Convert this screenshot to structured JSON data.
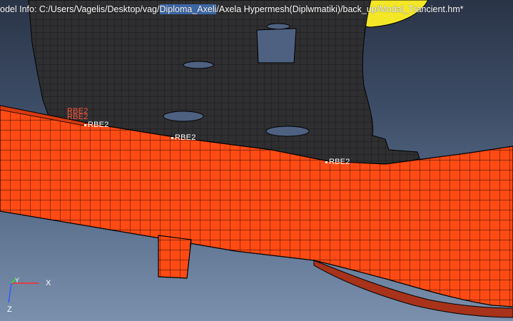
{
  "window": {
    "model_info": "odel Info: C:/Users/Vagelis/Desktop/vag/Diploma_Axeli/Axela Hypermesh(Diplwmatiki)/back_up/Modal_Trancient.hm*"
  },
  "viewport": {
    "background_top": "#2a3447",
    "background_bottom": "#7b90ad"
  },
  "model": {
    "rigid_labels": [
      {
        "text": "RBE2",
        "color": "#ff5a3c"
      },
      {
        "text": "RBE2",
        "color": "#ff5a3c"
      },
      {
        "text": "RBE2",
        "color": "#ffffff"
      },
      {
        "text": "RBE2",
        "color": "#ffffff"
      },
      {
        "text": "RBE2",
        "color": "#ffffff"
      }
    ],
    "colors": {
      "mesh_orange": "#ff4a14",
      "bracket_dark": "#2d2d2f",
      "edge_line": "#000000",
      "part_yellow": "#f4e826"
    }
  },
  "triad": {
    "x_label": "X",
    "y_label": "Y",
    "z_label": "Z"
  }
}
